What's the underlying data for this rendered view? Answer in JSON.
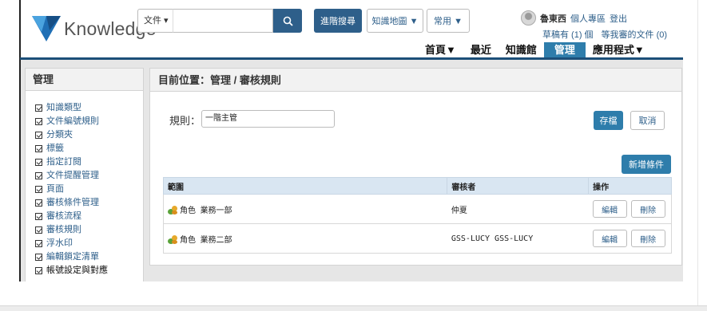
{
  "header": {
    "logo_text": "Knowledge",
    "search": {
      "scope": "文件",
      "placeholder": ""
    },
    "advanced_search": "進階搜尋",
    "knowledge_map": "知識地圖 ▼",
    "common": "常用 ▼",
    "user": {
      "name": "魯東西",
      "personal_area": "個人專區",
      "logout": "登出",
      "drafts": "草稿有 (1) 個",
      "pending_review": "等我審的文件 (0)"
    }
  },
  "main_nav": [
    "首頁▼",
    "最近",
    "知識館",
    "管理",
    "應用程式▼"
  ],
  "main_nav_active": "管理",
  "sidebar": {
    "title": "管理",
    "items": [
      "知識類型",
      "文件編號規則",
      "分類夾",
      "標籤",
      "指定訂閱",
      "文件提醒管理",
      "頁面",
      "審核條件管理",
      "審核流程",
      "審核規則",
      "浮水印",
      "編輯鎖定清單",
      "帳號設定與對應"
    ]
  },
  "panel": {
    "breadcrumb": "目前位置：管理 / 審核規則",
    "rule_label": "規則：",
    "rule_value": "一階主管",
    "save": "存檔",
    "cancel": "取消",
    "add_condition": "新增條件",
    "table": {
      "headers": [
        "範圍",
        "審核者",
        "操作"
      ],
      "rows": [
        {
          "scope_type": "角色",
          "scope_name": "業務一部",
          "reviewer": "仲夏",
          "edit": "編輯",
          "delete": "刪除"
        },
        {
          "scope_type": "角色",
          "scope_name": "業務二部",
          "reviewer": "GSS-LUCY GSS-LUCY",
          "edit": "編輯",
          "delete": "刪除"
        }
      ]
    }
  },
  "colors": {
    "primary_dark": "#2e5f8a",
    "primary": "#2e7dab",
    "nav_bar": "#1c4f79",
    "table_header": "#d9e6f2"
  }
}
